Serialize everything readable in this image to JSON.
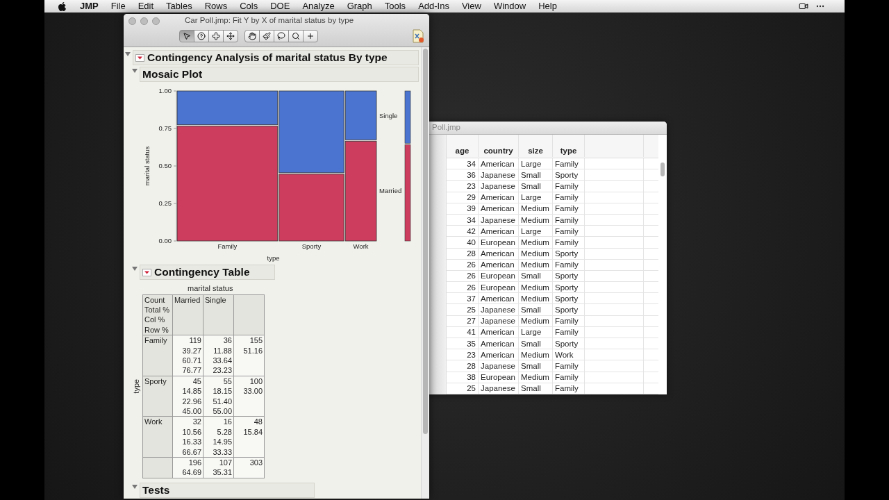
{
  "menu_bar": {
    "app": "JMP",
    "items": [
      "File",
      "Edit",
      "Tables",
      "Rows",
      "Cols",
      "DOE",
      "Analyze",
      "Graph",
      "Tools",
      "Add-Ins",
      "View",
      "Window",
      "Help"
    ]
  },
  "report_window": {
    "title": "Car Poll.jmp: Fit Y by X of marital status by type",
    "tools": [
      {
        "kind": "pointer",
        "selected": true
      },
      {
        "kind": "help",
        "selected": false
      },
      {
        "kind": "cross",
        "selected": false
      },
      {
        "kind": "move",
        "selected": false
      },
      {
        "kind": "hand",
        "selected": false
      },
      {
        "kind": "brush",
        "selected": false
      },
      {
        "kind": "lasso",
        "selected": false
      },
      {
        "kind": "zoom",
        "selected": false
      },
      {
        "kind": "crosshair",
        "selected": false
      }
    ],
    "report": {
      "title": "Contingency Analysis of marital status By type",
      "expanded": true,
      "mosaic": {
        "title": "Mosaic Plot",
        "expanded": true,
        "chart_data": {
          "type": "bar",
          "stacked": true,
          "xlabel": "type",
          "ylabel": "marital status",
          "categories": [
            "Family",
            "Sporty",
            "Work"
          ],
          "series": [
            {
              "name": "Married",
              "color": "#cc3d5e",
              "values": [
                0.77,
                0.45,
                0.67
              ]
            },
            {
              "name": "Single",
              "color": "#4a74d0",
              "values": [
                0.23,
                0.55,
                0.33
              ]
            }
          ],
          "ylim": [
            0,
            1
          ],
          "yticks": [
            {
              "value": 0,
              "label": "0.00"
            },
            {
              "value": 0.25,
              "label": "0.25"
            },
            {
              "value": 0.5,
              "label": "0.50"
            },
            {
              "value": 0.75,
              "label": "0.75"
            },
            {
              "value": 1,
              "label": "1.00"
            }
          ]
        }
      },
      "contingency": {
        "title": "Contingency Table",
        "expanded": true,
        "column_group": "marital status",
        "row_group": "type",
        "legend": [
          "Count",
          "Total %",
          "Col %",
          "Row %"
        ],
        "columns": [
          "Married",
          "Single"
        ],
        "rows": [
          {
            "label": "Family",
            "cells": [
              [
                "119",
                "39.27",
                "60.71",
                "76.77"
              ],
              [
                "36",
                "11.88",
                "33.64",
                "23.23"
              ],
              [
                "155",
                "51.16"
              ]
            ]
          },
          {
            "label": "Sporty",
            "cells": [
              [
                "45",
                "14.85",
                "22.96",
                "45.00"
              ],
              [
                "55",
                "18.15",
                "51.40",
                "55.00"
              ],
              [
                "100",
                "33.00"
              ]
            ]
          },
          {
            "label": "Work",
            "cells": [
              [
                "32",
                "10.56",
                "16.33",
                "66.67"
              ],
              [
                "16",
                "5.28",
                "14.95",
                "33.33"
              ],
              [
                "48",
                "15.84"
              ]
            ]
          }
        ],
        "totals": [
          [
            "196",
            "64.69"
          ],
          [
            "107",
            "35.31"
          ],
          [
            "303"
          ]
        ]
      },
      "tests": {
        "title": "Tests",
        "expanded": true
      }
    }
  },
  "data_window": {
    "title": "Poll.jmp",
    "columns": [
      "age",
      "country",
      "size",
      "type"
    ],
    "rows": [
      [
        "34",
        "American",
        "Large",
        "Family"
      ],
      [
        "36",
        "Japanese",
        "Small",
        "Sporty"
      ],
      [
        "23",
        "Japanese",
        "Small",
        "Family"
      ],
      [
        "29",
        "American",
        "Large",
        "Family"
      ],
      [
        "39",
        "American",
        "Medium",
        "Family"
      ],
      [
        "34",
        "Japanese",
        "Medium",
        "Family"
      ],
      [
        "42",
        "American",
        "Large",
        "Family"
      ],
      [
        "40",
        "European",
        "Medium",
        "Family"
      ],
      [
        "28",
        "American",
        "Medium",
        "Sporty"
      ],
      [
        "26",
        "American",
        "Medium",
        "Family"
      ],
      [
        "26",
        "European",
        "Small",
        "Sporty"
      ],
      [
        "26",
        "European",
        "Medium",
        "Sporty"
      ],
      [
        "37",
        "American",
        "Medium",
        "Sporty"
      ],
      [
        "25",
        "Japanese",
        "Small",
        "Sporty"
      ],
      [
        "27",
        "Japanese",
        "Medium",
        "Family"
      ],
      [
        "41",
        "American",
        "Large",
        "Family"
      ],
      [
        "35",
        "American",
        "Small",
        "Sporty"
      ],
      [
        "23",
        "American",
        "Medium",
        "Work"
      ],
      [
        "28",
        "Japanese",
        "Small",
        "Family"
      ],
      [
        "38",
        "European",
        "Medium",
        "Family"
      ],
      [
        "25",
        "Japanese",
        "Small",
        "Family"
      ]
    ]
  }
}
